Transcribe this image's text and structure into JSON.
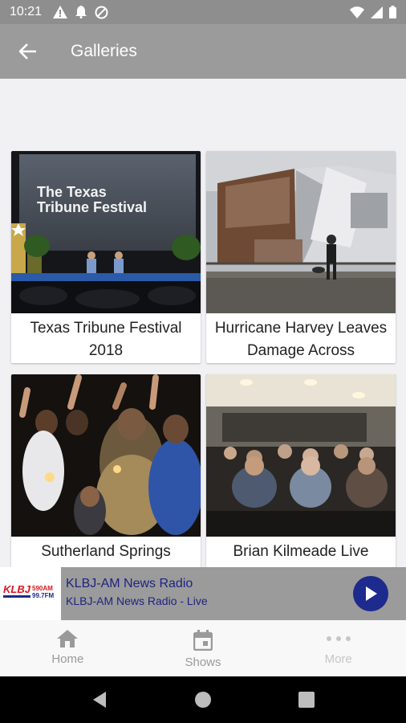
{
  "status_bar": {
    "time": "10:21"
  },
  "app_bar": {
    "title": "Galleries"
  },
  "galleries": [
    {
      "caption": "Texas Tribune Festival 2018"
    },
    {
      "caption": "Hurricane Harvey Leaves Damage Across"
    },
    {
      "caption": "Sutherland Springs"
    },
    {
      "caption": "Brian Kilmeade Live"
    }
  ],
  "photo_text": {
    "screen_line1": "The Texas",
    "screen_line2": "Tribune Festival"
  },
  "player": {
    "logo_top": "KLBJ",
    "logo_am": "590AM",
    "logo_fm": "99.7FM",
    "station": "KLBJ-AM News Radio",
    "subtitle": "KLBJ-AM News Radio - Live"
  },
  "bottom_nav": [
    {
      "label": "Home",
      "icon": "home-icon"
    },
    {
      "label": "Shows",
      "icon": "calendar-icon"
    },
    {
      "label": "More",
      "icon": "more-dots-icon"
    }
  ],
  "colors": {
    "app_bar": "#9b9b9b",
    "status_bar": "#8e8e8e",
    "player_accent": "#1d2a8e",
    "brand_red": "#d7171f"
  }
}
